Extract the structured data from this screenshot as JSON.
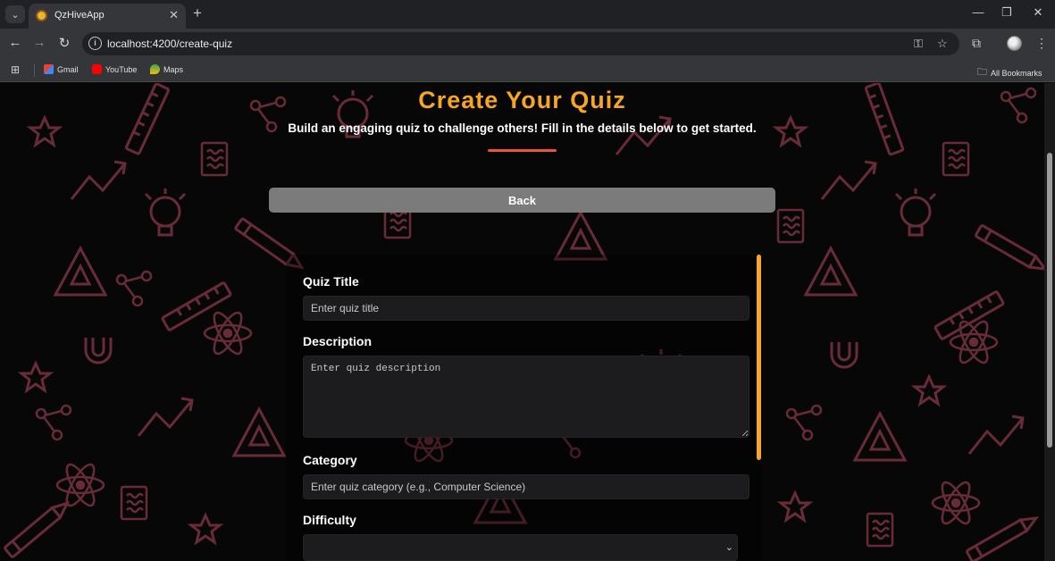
{
  "browser": {
    "tab_title": "QzHiveApp",
    "url": "localhost:4200/create-quiz",
    "bookmarks": [
      "Gmail",
      "YouTube",
      "Maps"
    ],
    "all_bookmarks": "All Bookmarks"
  },
  "page": {
    "title": "Create Your Quiz",
    "subtitle": "Build an engaging quiz to challenge others! Fill in the details below to get started.",
    "back_label": "Back"
  },
  "form": {
    "quiz_title_label": "Quiz Title",
    "quiz_title_placeholder": "Enter quiz title",
    "description_label": "Description",
    "description_placeholder": "Enter quiz description",
    "category_label": "Category",
    "category_placeholder": "Enter quiz category (e.g., Computer Science)",
    "difficulty_label": "Difficulty",
    "difficulty_value": ""
  },
  "colors": {
    "title": "#f6a623",
    "accent_bar": "#f6a623",
    "underline": "#e8553a",
    "back_button": "#7b7b7b",
    "doodle": "#6e2f3c"
  }
}
